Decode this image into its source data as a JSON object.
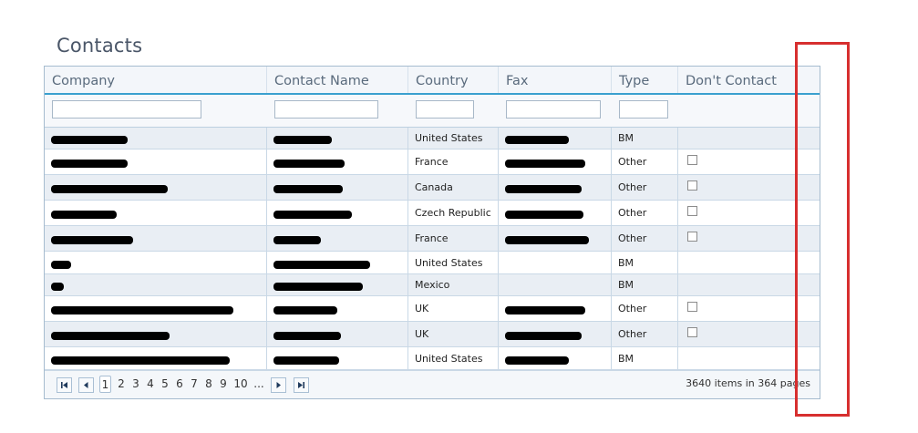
{
  "page": {
    "title": "Contacts"
  },
  "grid": {
    "columns": [
      {
        "key": "company",
        "label": "Company"
      },
      {
        "key": "contact",
        "label": "Contact Name"
      },
      {
        "key": "country",
        "label": "Country"
      },
      {
        "key": "fax",
        "label": "Fax"
      },
      {
        "key": "type",
        "label": "Type"
      },
      {
        "key": "dont_contact",
        "label": "Don't Contact"
      }
    ],
    "filters": {
      "company": "",
      "contact": "",
      "country": "",
      "fax": "",
      "type": ""
    },
    "rows": [
      {
        "company": "[redacted]",
        "contact": "[redacted]",
        "country": "United States",
        "fax": "[redacted]",
        "type": "BM",
        "dont_contact": null
      },
      {
        "company": "[redacted]",
        "contact": "[redacted]",
        "country": "France",
        "fax": "[redacted]",
        "type": "Other",
        "dont_contact": false
      },
      {
        "company": "[redacted]",
        "contact": "[redacted]",
        "country": "Canada",
        "fax": "[redacted]",
        "type": "Other",
        "dont_contact": false
      },
      {
        "company": "[redacted]",
        "contact": "[redacted]",
        "country": "Czech Republic",
        "fax": "[redacted]",
        "type": "Other",
        "dont_contact": false
      },
      {
        "company": "[redacted]",
        "contact": "[redacted]",
        "country": "France",
        "fax": "[redacted]",
        "type": "Other",
        "dont_contact": false
      },
      {
        "company": "[redacted]",
        "contact": "[redacted]",
        "country": "United States",
        "fax": "",
        "type": "BM",
        "dont_contact": null
      },
      {
        "company": "[redacted]",
        "contact": "[redacted]",
        "country": "Mexico",
        "fax": "",
        "type": "BM",
        "dont_contact": null
      },
      {
        "company": "[redacted]",
        "contact": "[redacted]",
        "country": "UK",
        "fax": "[redacted]",
        "type": "Other",
        "dont_contact": false
      },
      {
        "company": "[redacted]",
        "contact": "[redacted]",
        "country": "UK",
        "fax": "[redacted]",
        "type": "Other",
        "dont_contact": false
      },
      {
        "company": "[redacted]",
        "contact": "[redacted]",
        "country": "United States",
        "fax": "[redacted]",
        "type": "BM",
        "dont_contact": null
      }
    ]
  },
  "pager": {
    "pages": [
      "1",
      "2",
      "3",
      "4",
      "5",
      "6",
      "7",
      "8",
      "9",
      "10",
      "..."
    ],
    "current": "1",
    "total_items": "3640",
    "total_pages": "364",
    "items_text": "items in",
    "pages_text": "pages"
  },
  "icons": {
    "first": "first-page-icon",
    "prev": "prev-page-icon",
    "next": "next-page-icon",
    "last": "last-page-icon"
  },
  "colors": {
    "header_underline": "#3aa0cf",
    "row_alt": "#e9eef4",
    "annotation": "#d72f2f"
  }
}
